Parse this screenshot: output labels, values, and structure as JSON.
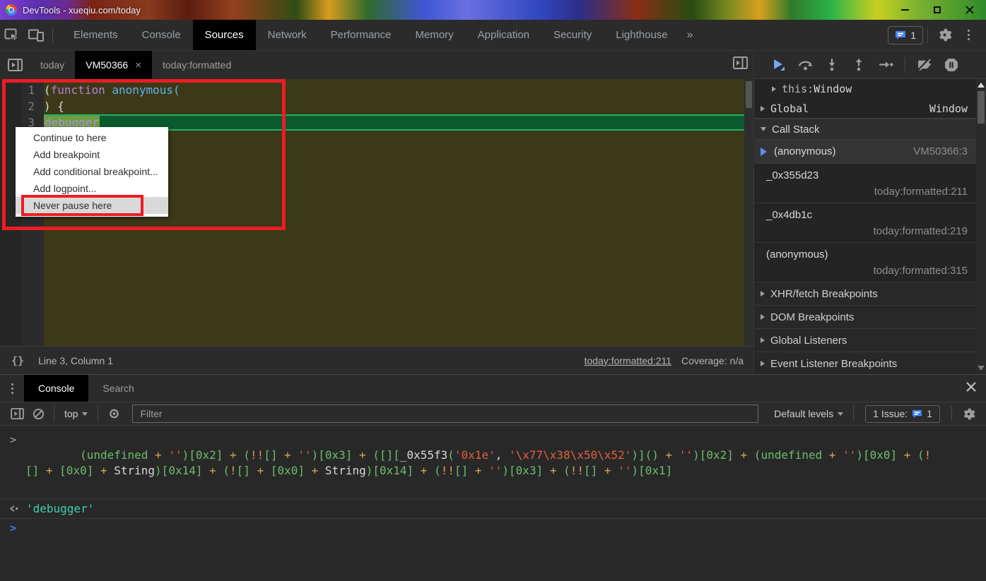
{
  "colors": {
    "accent_blue": "#4285f4",
    "annotation_red": "#ec1c24",
    "paused_line_green": "#0b5a2e",
    "editor_background_olive": "#3b3917",
    "result_teal": "#3ed1b2"
  },
  "titlebar": {
    "title": "DevTools - xueqiu.com/today"
  },
  "main_toolbar": {
    "tabs": [
      {
        "label": "Elements"
      },
      {
        "label": "Console"
      },
      {
        "label": "Sources",
        "active": true
      },
      {
        "label": "Network"
      },
      {
        "label": "Performance"
      },
      {
        "label": "Memory"
      },
      {
        "label": "Application"
      },
      {
        "label": "Security"
      },
      {
        "label": "Lighthouse"
      }
    ],
    "more": "»",
    "issues_count": "1"
  },
  "file_tabs": {
    "tabs": [
      {
        "label": "today"
      },
      {
        "label": "VM50366",
        "close": "×",
        "active": true
      },
      {
        "label": "today:formatted"
      }
    ]
  },
  "editor": {
    "lines": [
      {
        "num": "1",
        "tokens": [
          {
            "t": "(",
            "c": "pln"
          },
          {
            "t": "function",
            "c": "kw"
          },
          {
            "t": " anonymous",
            "c": "fn"
          },
          {
            "t": "(",
            "c": "fn"
          }
        ]
      },
      {
        "num": "2",
        "tokens": [
          {
            "t": ") {",
            "c": "pln"
          }
        ]
      },
      {
        "num": "3",
        "current": true,
        "tokens": [
          {
            "t": "debugger",
            "c": "dbg"
          }
        ]
      }
    ]
  },
  "context_menu": {
    "items": [
      {
        "label": "Continue to here"
      },
      {
        "label": "Add breakpoint"
      },
      {
        "label": "Add conditional breakpoint..."
      },
      {
        "label": "Add logpoint..."
      },
      {
        "label": "Never pause here",
        "highlighted": true
      }
    ]
  },
  "status_bar": {
    "braces": "{}",
    "position": "Line 3, Column 1",
    "link": "today:formatted:211",
    "coverage": "Coverage: n/a"
  },
  "sidebar": {
    "scope": {
      "this_name": "this: ",
      "this_value": "Window",
      "global_name": "Global",
      "global_value": "Window"
    },
    "call_stack_title": "Call Stack",
    "frames": [
      {
        "name": "(anonymous)",
        "location": "VM50366:3",
        "active": true
      },
      {
        "name": "_0x355d23",
        "location": "today:formatted:211"
      },
      {
        "name": "_0x4db1c",
        "location": "today:formatted:219"
      },
      {
        "name": "(anonymous)",
        "location": "today:formatted:315"
      }
    ],
    "sections": [
      {
        "label": "XHR/fetch Breakpoints"
      },
      {
        "label": "DOM Breakpoints"
      },
      {
        "label": "Global Listeners"
      },
      {
        "label": "Event Listener Breakpoints"
      }
    ]
  },
  "drawer": {
    "tabs": [
      {
        "label": "Console",
        "active": true
      },
      {
        "label": "Search"
      }
    ],
    "toolbar": {
      "context_selector": "top",
      "filter_placeholder": "Filter",
      "levels_label": "Default levels",
      "issues_label": "1 Issue:",
      "issues_count": "1"
    },
    "console": {
      "eval_chevron": ">",
      "prompt_chevron": ">",
      "eval_tokens": [
        {
          "t": "(",
          "c": "g"
        },
        {
          "t": "undefined",
          "c": "g"
        },
        {
          "t": " + ",
          "c": "o"
        },
        {
          "t": "''",
          "c": "s"
        },
        {
          "t": ")[0x2]",
          "c": "g"
        },
        {
          "t": " + ",
          "c": "o"
        },
        {
          "t": "(",
          "c": "g"
        },
        {
          "t": "!!",
          "c": "o"
        },
        {
          "t": "[]",
          "c": "g"
        },
        {
          "t": " + ",
          "c": "o"
        },
        {
          "t": "''",
          "c": "s"
        },
        {
          "t": ")[0x3]",
          "c": "g"
        },
        {
          "t": " + ",
          "c": "o"
        },
        {
          "t": "([][",
          "c": "g"
        },
        {
          "t": "_0x55f3",
          "c": "w"
        },
        {
          "t": "(",
          "c": "g"
        },
        {
          "t": "'0x1e'",
          "c": "s"
        },
        {
          "t": ", ",
          "c": "w"
        },
        {
          "t": "'\\x77\\x38\\x50\\x52'",
          "c": "s"
        },
        {
          "t": ")]()",
          "c": "g"
        },
        {
          "t": " + ",
          "c": "o"
        },
        {
          "t": "''",
          "c": "s"
        },
        {
          "t": ")[0x2]",
          "c": "g"
        },
        {
          "t": " + ",
          "c": "o"
        },
        {
          "t": "(",
          "c": "g"
        },
        {
          "t": "undefined",
          "c": "g"
        },
        {
          "t": " + ",
          "c": "o"
        },
        {
          "t": "''",
          "c": "s"
        },
        {
          "t": ")[0x0]",
          "c": "g"
        },
        {
          "t": " + ",
          "c": "o"
        },
        {
          "t": "(",
          "c": "g"
        },
        {
          "t": "!",
          "c": "o"
        },
        {
          "t": "[]",
          "c": "g"
        },
        {
          "t": " + ",
          "c": "o"
        },
        {
          "t": "[0x0]",
          "c": "g"
        },
        {
          "t": " + ",
          "c": "o"
        },
        {
          "t": "String",
          "c": "w"
        },
        {
          "t": ")[0x14]",
          "c": "g"
        },
        {
          "t": " + ",
          "c": "o"
        },
        {
          "t": "(",
          "c": "g"
        },
        {
          "t": "!",
          "c": "o"
        },
        {
          "t": "[]",
          "c": "g"
        },
        {
          "t": " + ",
          "c": "o"
        },
        {
          "t": "[0x0]",
          "c": "g"
        },
        {
          "t": " + ",
          "c": "o"
        },
        {
          "t": "String",
          "c": "w"
        },
        {
          "t": ")[0x14]",
          "c": "g"
        },
        {
          "t": " + ",
          "c": "o"
        },
        {
          "t": "(",
          "c": "g"
        },
        {
          "t": "!!",
          "c": "o"
        },
        {
          "t": "[]",
          "c": "g"
        },
        {
          "t": " + ",
          "c": "o"
        },
        {
          "t": "''",
          "c": "s"
        },
        {
          "t": ")[0x3]",
          "c": "g"
        },
        {
          "t": " + ",
          "c": "o"
        },
        {
          "t": "(",
          "c": "g"
        },
        {
          "t": "!!",
          "c": "o"
        },
        {
          "t": "[]",
          "c": "g"
        },
        {
          "t": " + ",
          "c": "o"
        },
        {
          "t": "''",
          "c": "s"
        },
        {
          "t": ")[0x1]",
          "c": "g"
        }
      ],
      "result": "'debugger'"
    }
  }
}
